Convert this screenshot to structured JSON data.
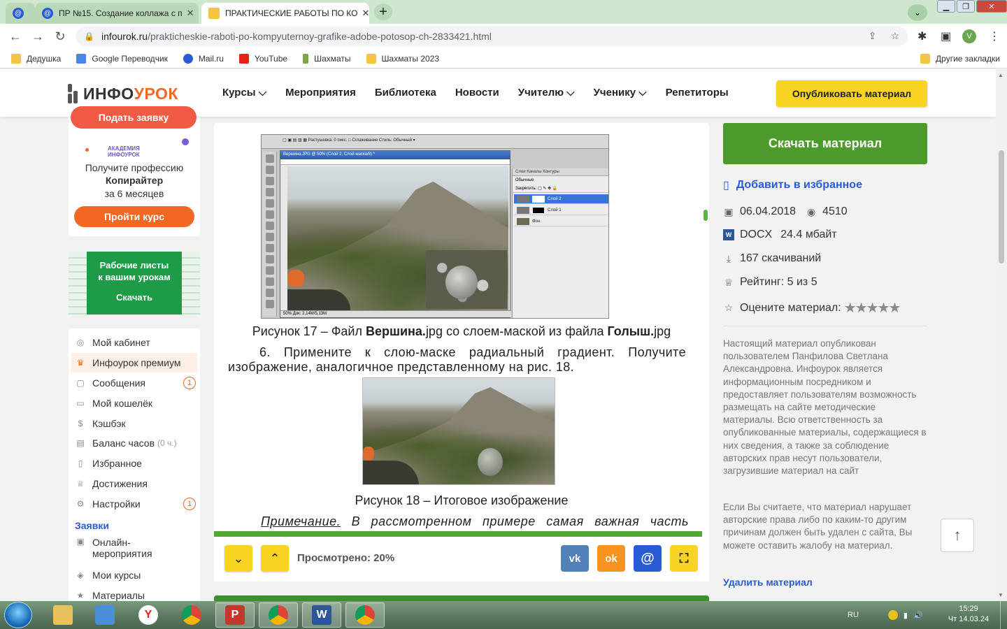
{
  "browser": {
    "tabs": [
      {
        "label": ""
      },
      {
        "label": "ПР №15. Создание коллажа с п"
      },
      {
        "label": "ПРАКТИЧЕСКИЕ РАБОТЫ ПО КО"
      }
    ],
    "url_host": "infourok.ru",
    "url_path": "/prakticheskie-raboti-po-kompyuternoy-grafike-adobe-potosop-ch-2833421.html",
    "avatar_letter": "V",
    "bookmarks": [
      {
        "label": "Дедушка",
        "icon": "folder-icon"
      },
      {
        "label": "Google Переводчик",
        "icon": "translate-icon"
      },
      {
        "label": "Mail.ru",
        "icon": "mail-icon"
      },
      {
        "label": "YouTube",
        "icon": "youtube-icon"
      },
      {
        "label": "Шахматы",
        "icon": "chess-icon"
      },
      {
        "label": "Шахматы 2023",
        "icon": "folder-icon"
      }
    ],
    "other_bookmarks": "Другие закладки"
  },
  "site": {
    "logo_a": "ИНФО",
    "logo_b": "УРОК",
    "menu": [
      "Курсы",
      "Мероприятия",
      "Библиотека",
      "Новости",
      "Учителю",
      "Ученику",
      "Репетиторы"
    ],
    "publish": "Опубликовать материал"
  },
  "left": {
    "top_button": "Подать заявку",
    "academy": "АКАДЕМИЯ\nИНФОУРОК",
    "promo_line1": "Получите профессию",
    "promo_line2": "Копирайтер",
    "promo_line3": "за 6 месяцев",
    "promo_button": "Пройти курс",
    "banner_line1": "Рабочие листы",
    "banner_line2": "к вашим урокам",
    "banner_button": "Скачать",
    "menu": [
      {
        "label": "Мой кабинет",
        "icon": "user-icon"
      },
      {
        "label": "Инфоурок премиум",
        "icon": "crown-icon"
      },
      {
        "label": "Сообщения",
        "icon": "message-icon",
        "badge": "1"
      },
      {
        "label": "Мой кошелёк",
        "icon": "wallet-icon"
      },
      {
        "label": "Кэшбэк",
        "icon": "cashback-icon"
      },
      {
        "label": "Баланс часов",
        "icon": "clock-icon",
        "sub": "(0 ч.)"
      },
      {
        "label": "Избранное",
        "icon": "bookmark-icon"
      },
      {
        "label": "Достижения",
        "icon": "trophy-icon"
      },
      {
        "label": "Настройки",
        "icon": "gear-icon",
        "badge": "1"
      }
    ],
    "section": "Заявки",
    "menu2": [
      {
        "label": "Онлайн-\nмероприятия",
        "icon": "calendar-icon"
      },
      {
        "label": "Мои курсы",
        "icon": "courses-icon"
      },
      {
        "label": "Материалы",
        "icon": "star-icon"
      }
    ]
  },
  "document": {
    "ps_title": "Вершина.JPG @ 50% (Слой 2, Слой-маска/8) *",
    "ps_layers": [
      "Слой 2",
      "Слой 1",
      "Фон"
    ],
    "ps_tabs": "Слои   Каналы   Контуры",
    "ps_mode": "Обычные",
    "ps_zoom": "50%",
    "ps_doc": "Док: 2,14M/5,13M",
    "caption17_a": "Рисунок 17 – Файл ",
    "caption17_b": "Вершина.",
    "caption17_c": "jpg со слоем-маской из файла ",
    "caption17_d": "Голыш.",
    "caption17_e": "jpg",
    "step6": "6.   Примените к слою-маске радиальный градиент. Получите изображение, аналогичное представленному на рис. 18.",
    "caption18": "Рисунок 18 – Итоговое изображение",
    "note_label": "Примечание.",
    "note_words": [
      "В",
      "рассмотренном",
      "примере",
      "самая",
      "важная",
      "часть"
    ],
    "viewed": "Просмотрено: 20%",
    "viewed_fraction": 0.2,
    "share": [
      {
        "label": "vk",
        "color": "#5181b8",
        "icon": "vk-icon"
      },
      {
        "label": "ok",
        "color": "#f7931e",
        "icon": "odnoklassniki-icon"
      },
      {
        "label": "@",
        "color": "#2a5bd7",
        "icon": "mail-icon"
      },
      {
        "label": "⛶",
        "color": "#f9d423",
        "icon": "fullscreen-icon"
      }
    ]
  },
  "right": {
    "download": "Скачать материал",
    "favorite": "Добавить в избранное",
    "date": "06.04.2018",
    "views": "4510",
    "format": "DOCX",
    "size": "24.4 мбайт",
    "downloads": "167 скачиваний",
    "rating": "Рейтинг: 5 из 5",
    "rate_label": "Оцените материал:",
    "stars": 5,
    "disclaimer1": "Настоящий материал опубликован пользователем Панфилова Светлана Александровна. Инфоурок является информационным посредником и предоставляет пользователям возможность размещать на сайте методические материалы. Всю ответственность за опубликованные материалы, содержащиеся в них сведения, а также за соблюдение авторских прав несут пользователи, загрузившие материал на сайт",
    "disclaimer2": "Если Вы считаете, что материал нарушает авторские права либо по каким-то другим причинам должен быть удален с сайта, Вы можете оставить жалобу на материал.",
    "delete": "Удалить материал"
  },
  "taskbar": {
    "lang": "RU",
    "time": "15:29",
    "date": "Чт 14.03.24"
  },
  "colors": {
    "accent_orange": "#f26722",
    "accent_green": "#4c9b2b",
    "link_blue": "#2a5bd7",
    "publish_yellow": "#f9d423"
  }
}
